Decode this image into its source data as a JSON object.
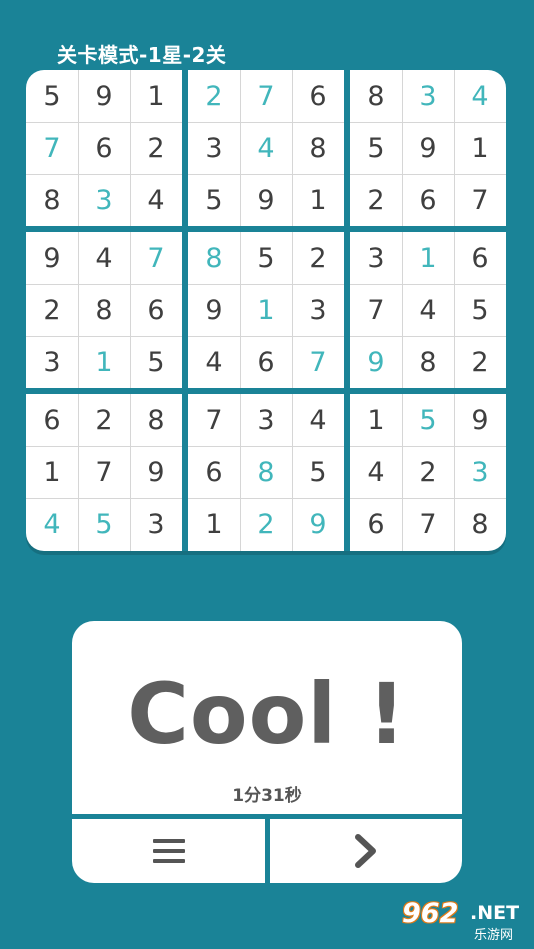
{
  "header": {
    "level_title": "关卡模式-1星-2关"
  },
  "board": {
    "rows": [
      [
        5,
        9,
        1,
        2,
        7,
        6,
        8,
        3,
        4
      ],
      [
        7,
        6,
        2,
        3,
        4,
        8,
        5,
        9,
        1
      ],
      [
        8,
        3,
        4,
        5,
        9,
        1,
        2,
        6,
        7
      ],
      [
        9,
        4,
        7,
        8,
        5,
        2,
        3,
        1,
        6
      ],
      [
        2,
        8,
        6,
        9,
        1,
        3,
        7,
        4,
        5
      ],
      [
        3,
        1,
        5,
        4,
        6,
        7,
        9,
        8,
        2
      ],
      [
        6,
        2,
        8,
        7,
        3,
        4,
        1,
        5,
        9
      ],
      [
        1,
        7,
        9,
        6,
        8,
        5,
        4,
        2,
        3
      ],
      [
        4,
        5,
        3,
        1,
        2,
        9,
        6,
        7,
        8
      ]
    ],
    "player_filled": [
      [
        0,
        0,
        0,
        1,
        1,
        0,
        0,
        1,
        1
      ],
      [
        1,
        0,
        0,
        0,
        1,
        0,
        0,
        0,
        0
      ],
      [
        0,
        1,
        0,
        0,
        0,
        0,
        0,
        0,
        0
      ],
      [
        0,
        0,
        1,
        1,
        0,
        0,
        0,
        1,
        0
      ],
      [
        0,
        0,
        0,
        0,
        1,
        0,
        0,
        0,
        0
      ],
      [
        0,
        1,
        0,
        0,
        0,
        1,
        1,
        0,
        0
      ],
      [
        0,
        0,
        0,
        0,
        0,
        0,
        0,
        1,
        0
      ],
      [
        0,
        0,
        0,
        0,
        1,
        0,
        0,
        0,
        1
      ],
      [
        1,
        1,
        0,
        0,
        1,
        1,
        0,
        0,
        0
      ]
    ]
  },
  "result": {
    "message": "Cool !",
    "time": "1分31秒"
  },
  "buttons": {
    "menu_icon": "menu-icon",
    "next_icon": "chevron-right-icon"
  },
  "watermark": {
    "number": "962",
    "net": ".NET",
    "site": "乐游网"
  },
  "colors": {
    "background": "#1a8397",
    "given_digit": "#3f3f3f",
    "filled_digit": "#41b6bb",
    "card": "#ffffff"
  }
}
